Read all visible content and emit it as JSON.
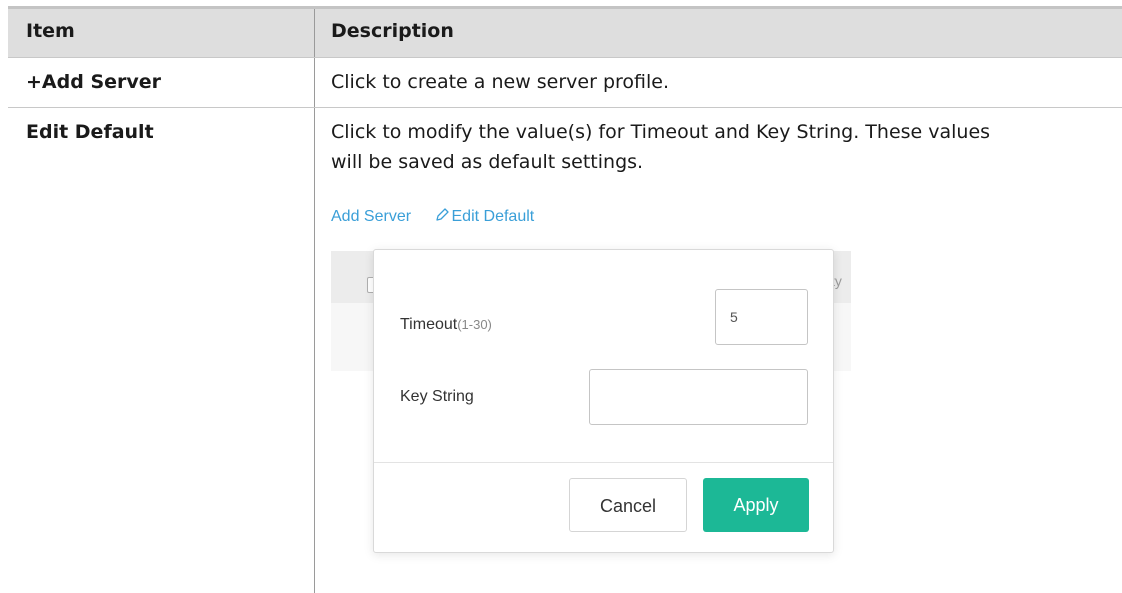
{
  "table": {
    "headers": {
      "item": "Item",
      "description": "Description"
    },
    "rows": [
      {
        "item": "+Add Server",
        "description": "Click to create a new server profile."
      },
      {
        "item": "Edit Default",
        "description_line1": "Click to modify the value(s) for Timeout and Key String. These values",
        "description_line2": "will be saved as default settings."
      }
    ]
  },
  "screenshot": {
    "toolbar": {
      "add_server": "Add Server",
      "edit_default": "Edit Default",
      "edit_icon": "pencil-icon"
    },
    "background_partial_text": "ty",
    "dialog": {
      "timeout_label": "Timeout",
      "timeout_range": "(1-30)",
      "timeout_value": "5",
      "key_string_label": "Key String",
      "key_string_value": "",
      "cancel_label": "Cancel",
      "apply_label": "Apply"
    },
    "colors": {
      "accent": "#1cb896",
      "link": "#3a9fd8"
    }
  }
}
